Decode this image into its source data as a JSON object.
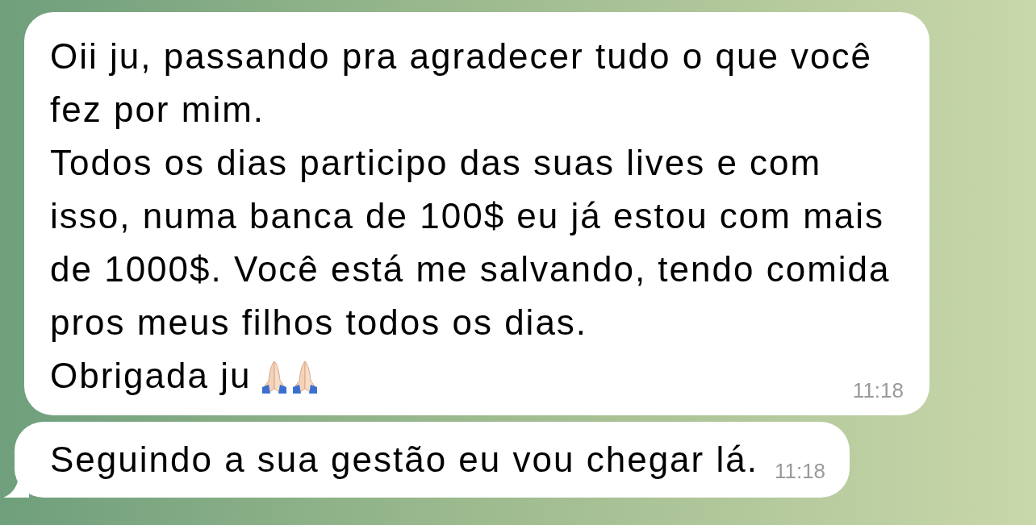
{
  "messages": [
    {
      "paragraphs": [
        "Oii ju, passando pra agradecer tudo o que você fez por mim.",
        "Todos os dias participo das suas lives e com isso, numa banca de 100$ eu já estou com mais de 1000$. Você está me salvando, tendo comida pros meus filhos todos os dias."
      ],
      "closing": {
        "text": "Obrigada ju",
        "icons": [
          {
            "kind": "praying-hands"
          },
          {
            "kind": "praying-hands"
          }
        ]
      },
      "time": "11:18",
      "tail": false
    },
    {
      "paragraphs": [
        "Seguindo a sua gestão eu vou chegar lá."
      ],
      "time": "11:18",
      "tail": true
    }
  ]
}
